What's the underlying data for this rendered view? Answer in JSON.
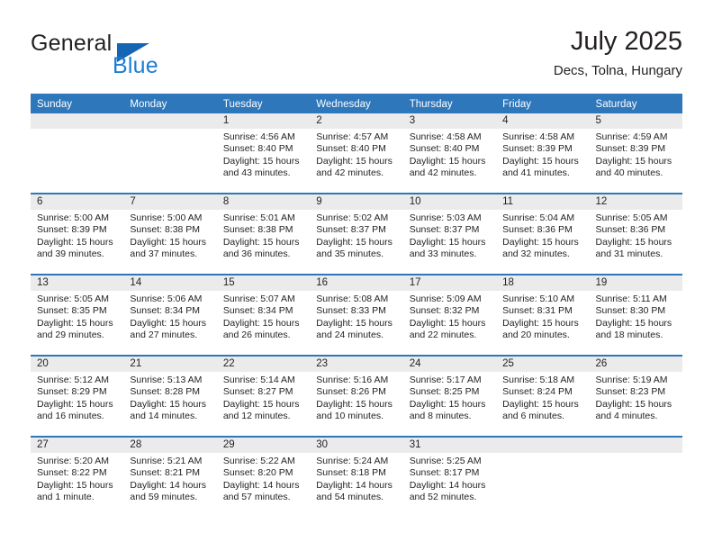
{
  "brand": {
    "name_part1": "General",
    "name_part2": "Blue",
    "triangle_color": "#1565b5",
    "blue_color": "#1b7fd4"
  },
  "header": {
    "title": "July 2025",
    "location": "Decs, Tolna, Hungary"
  },
  "theme": {
    "header_row_bg": "#2e77bb",
    "day_strip_bg": "#ebebeb",
    "text_color": "#231f20"
  },
  "calendar": {
    "weekdays": [
      "Sunday",
      "Monday",
      "Tuesday",
      "Wednesday",
      "Thursday",
      "Friday",
      "Saturday"
    ],
    "weeks": [
      [
        {
          "day": "",
          "empty": true,
          "sunrise": "",
          "sunset": "",
          "daylight1": "",
          "daylight2": ""
        },
        {
          "day": "",
          "empty": true,
          "sunrise": "",
          "sunset": "",
          "daylight1": "",
          "daylight2": ""
        },
        {
          "day": "1",
          "sunrise": "Sunrise: 4:56 AM",
          "sunset": "Sunset: 8:40 PM",
          "daylight1": "Daylight: 15 hours",
          "daylight2": "and 43 minutes."
        },
        {
          "day": "2",
          "sunrise": "Sunrise: 4:57 AM",
          "sunset": "Sunset: 8:40 PM",
          "daylight1": "Daylight: 15 hours",
          "daylight2": "and 42 minutes."
        },
        {
          "day": "3",
          "sunrise": "Sunrise: 4:58 AM",
          "sunset": "Sunset: 8:40 PM",
          "daylight1": "Daylight: 15 hours",
          "daylight2": "and 42 minutes."
        },
        {
          "day": "4",
          "sunrise": "Sunrise: 4:58 AM",
          "sunset": "Sunset: 8:39 PM",
          "daylight1": "Daylight: 15 hours",
          "daylight2": "and 41 minutes."
        },
        {
          "day": "5",
          "sunrise": "Sunrise: 4:59 AM",
          "sunset": "Sunset: 8:39 PM",
          "daylight1": "Daylight: 15 hours",
          "daylight2": "and 40 minutes."
        }
      ],
      [
        {
          "day": "6",
          "sunrise": "Sunrise: 5:00 AM",
          "sunset": "Sunset: 8:39 PM",
          "daylight1": "Daylight: 15 hours",
          "daylight2": "and 39 minutes."
        },
        {
          "day": "7",
          "sunrise": "Sunrise: 5:00 AM",
          "sunset": "Sunset: 8:38 PM",
          "daylight1": "Daylight: 15 hours",
          "daylight2": "and 37 minutes."
        },
        {
          "day": "8",
          "sunrise": "Sunrise: 5:01 AM",
          "sunset": "Sunset: 8:38 PM",
          "daylight1": "Daylight: 15 hours",
          "daylight2": "and 36 minutes."
        },
        {
          "day": "9",
          "sunrise": "Sunrise: 5:02 AM",
          "sunset": "Sunset: 8:37 PM",
          "daylight1": "Daylight: 15 hours",
          "daylight2": "and 35 minutes."
        },
        {
          "day": "10",
          "sunrise": "Sunrise: 5:03 AM",
          "sunset": "Sunset: 8:37 PM",
          "daylight1": "Daylight: 15 hours",
          "daylight2": "and 33 minutes."
        },
        {
          "day": "11",
          "sunrise": "Sunrise: 5:04 AM",
          "sunset": "Sunset: 8:36 PM",
          "daylight1": "Daylight: 15 hours",
          "daylight2": "and 32 minutes."
        },
        {
          "day": "12",
          "sunrise": "Sunrise: 5:05 AM",
          "sunset": "Sunset: 8:36 PM",
          "daylight1": "Daylight: 15 hours",
          "daylight2": "and 31 minutes."
        }
      ],
      [
        {
          "day": "13",
          "sunrise": "Sunrise: 5:05 AM",
          "sunset": "Sunset: 8:35 PM",
          "daylight1": "Daylight: 15 hours",
          "daylight2": "and 29 minutes."
        },
        {
          "day": "14",
          "sunrise": "Sunrise: 5:06 AM",
          "sunset": "Sunset: 8:34 PM",
          "daylight1": "Daylight: 15 hours",
          "daylight2": "and 27 minutes."
        },
        {
          "day": "15",
          "sunrise": "Sunrise: 5:07 AM",
          "sunset": "Sunset: 8:34 PM",
          "daylight1": "Daylight: 15 hours",
          "daylight2": "and 26 minutes."
        },
        {
          "day": "16",
          "sunrise": "Sunrise: 5:08 AM",
          "sunset": "Sunset: 8:33 PM",
          "daylight1": "Daylight: 15 hours",
          "daylight2": "and 24 minutes."
        },
        {
          "day": "17",
          "sunrise": "Sunrise: 5:09 AM",
          "sunset": "Sunset: 8:32 PM",
          "daylight1": "Daylight: 15 hours",
          "daylight2": "and 22 minutes."
        },
        {
          "day": "18",
          "sunrise": "Sunrise: 5:10 AM",
          "sunset": "Sunset: 8:31 PM",
          "daylight1": "Daylight: 15 hours",
          "daylight2": "and 20 minutes."
        },
        {
          "day": "19",
          "sunrise": "Sunrise: 5:11 AM",
          "sunset": "Sunset: 8:30 PM",
          "daylight1": "Daylight: 15 hours",
          "daylight2": "and 18 minutes."
        }
      ],
      [
        {
          "day": "20",
          "sunrise": "Sunrise: 5:12 AM",
          "sunset": "Sunset: 8:29 PM",
          "daylight1": "Daylight: 15 hours",
          "daylight2": "and 16 minutes."
        },
        {
          "day": "21",
          "sunrise": "Sunrise: 5:13 AM",
          "sunset": "Sunset: 8:28 PM",
          "daylight1": "Daylight: 15 hours",
          "daylight2": "and 14 minutes."
        },
        {
          "day": "22",
          "sunrise": "Sunrise: 5:14 AM",
          "sunset": "Sunset: 8:27 PM",
          "daylight1": "Daylight: 15 hours",
          "daylight2": "and 12 minutes."
        },
        {
          "day": "23",
          "sunrise": "Sunrise: 5:16 AM",
          "sunset": "Sunset: 8:26 PM",
          "daylight1": "Daylight: 15 hours",
          "daylight2": "and 10 minutes."
        },
        {
          "day": "24",
          "sunrise": "Sunrise: 5:17 AM",
          "sunset": "Sunset: 8:25 PM",
          "daylight1": "Daylight: 15 hours",
          "daylight2": "and 8 minutes."
        },
        {
          "day": "25",
          "sunrise": "Sunrise: 5:18 AM",
          "sunset": "Sunset: 8:24 PM",
          "daylight1": "Daylight: 15 hours",
          "daylight2": "and 6 minutes."
        },
        {
          "day": "26",
          "sunrise": "Sunrise: 5:19 AM",
          "sunset": "Sunset: 8:23 PM",
          "daylight1": "Daylight: 15 hours",
          "daylight2": "and 4 minutes."
        }
      ],
      [
        {
          "day": "27",
          "sunrise": "Sunrise: 5:20 AM",
          "sunset": "Sunset: 8:22 PM",
          "daylight1": "Daylight: 15 hours",
          "daylight2": "and 1 minute."
        },
        {
          "day": "28",
          "sunrise": "Sunrise: 5:21 AM",
          "sunset": "Sunset: 8:21 PM",
          "daylight1": "Daylight: 14 hours",
          "daylight2": "and 59 minutes."
        },
        {
          "day": "29",
          "sunrise": "Sunrise: 5:22 AM",
          "sunset": "Sunset: 8:20 PM",
          "daylight1": "Daylight: 14 hours",
          "daylight2": "and 57 minutes."
        },
        {
          "day": "30",
          "sunrise": "Sunrise: 5:24 AM",
          "sunset": "Sunset: 8:18 PM",
          "daylight1": "Daylight: 14 hours",
          "daylight2": "and 54 minutes."
        },
        {
          "day": "31",
          "sunrise": "Sunrise: 5:25 AM",
          "sunset": "Sunset: 8:17 PM",
          "daylight1": "Daylight: 14 hours",
          "daylight2": "and 52 minutes."
        },
        {
          "day": "",
          "empty": true,
          "sunrise": "",
          "sunset": "",
          "daylight1": "",
          "daylight2": ""
        },
        {
          "day": "",
          "empty": true,
          "sunrise": "",
          "sunset": "",
          "daylight1": "",
          "daylight2": ""
        }
      ]
    ]
  }
}
